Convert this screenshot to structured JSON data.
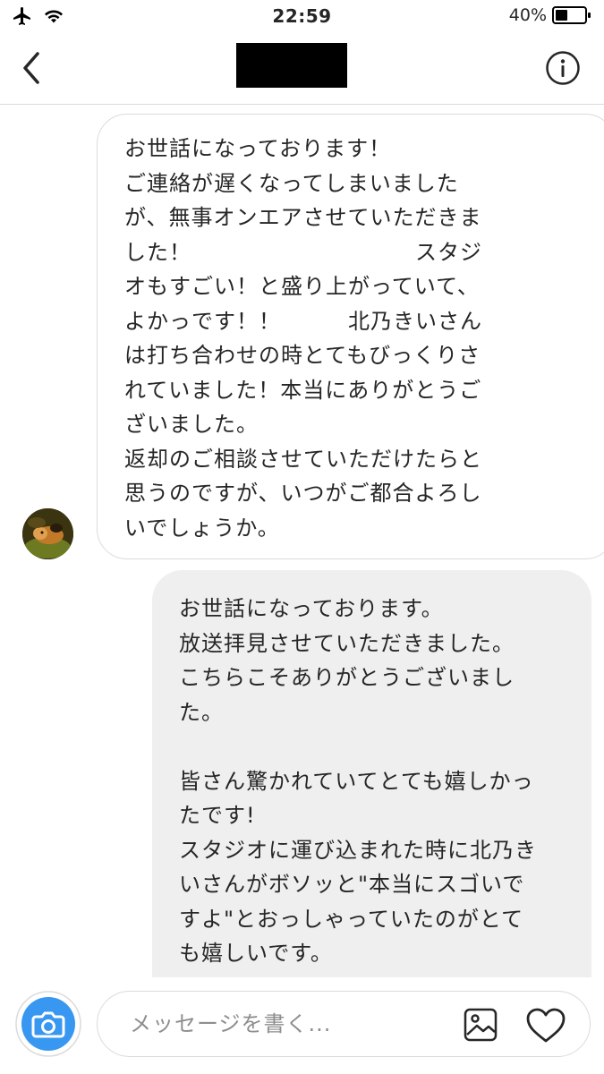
{
  "status_bar": {
    "time": "22:59",
    "battery": "40%"
  },
  "messages": {
    "incoming": {
      "lines": [
        "お世話になっております！",
        "ご連絡が遅くなってしまいました",
        "が、無事オンエアさせていただきま",
        "した！　　　　　　　　　　スタジ",
        "オもすごい！と盛り上がっていて、",
        "よかっです！！　　　北乃きいさん",
        "は打ち合わせの時とてもびっくりさ",
        "れていました！本当にありがとうご",
        "ざいました。",
        "返却のご相談させていただけたらと",
        "思うのですが、いつがご都合よろし",
        "いでしょうか。"
      ]
    },
    "outgoing": {
      "lines": [
        "お世話になっております。",
        "放送拝見させていただきました。",
        "こちらこそありがとうございまし",
        "た。",
        "",
        "皆さん驚かれていてとても嬉しかっ",
        "たです!",
        "スタジオに運び込まれた時に北乃き",
        "いさんがボソッと\"本当にスゴいで",
        "すよ\"とおっしゃっていたのがとて",
        "も嬉しいです。"
      ]
    }
  },
  "composer": {
    "placeholder": "メッセージを書く..."
  },
  "icons": {
    "back": "chevron-left-icon",
    "info": "info-icon",
    "camera": "camera-icon",
    "gallery": "gallery-icon",
    "like": "heart-icon",
    "airplane": "airplane-icon",
    "wifi": "wifi-icon",
    "battery": "battery-icon"
  },
  "colors": {
    "camera_button": "#3897f0",
    "outgoing_bubble": "#efefef",
    "border": "#dbdbdb",
    "placeholder": "#8e8e8e"
  }
}
